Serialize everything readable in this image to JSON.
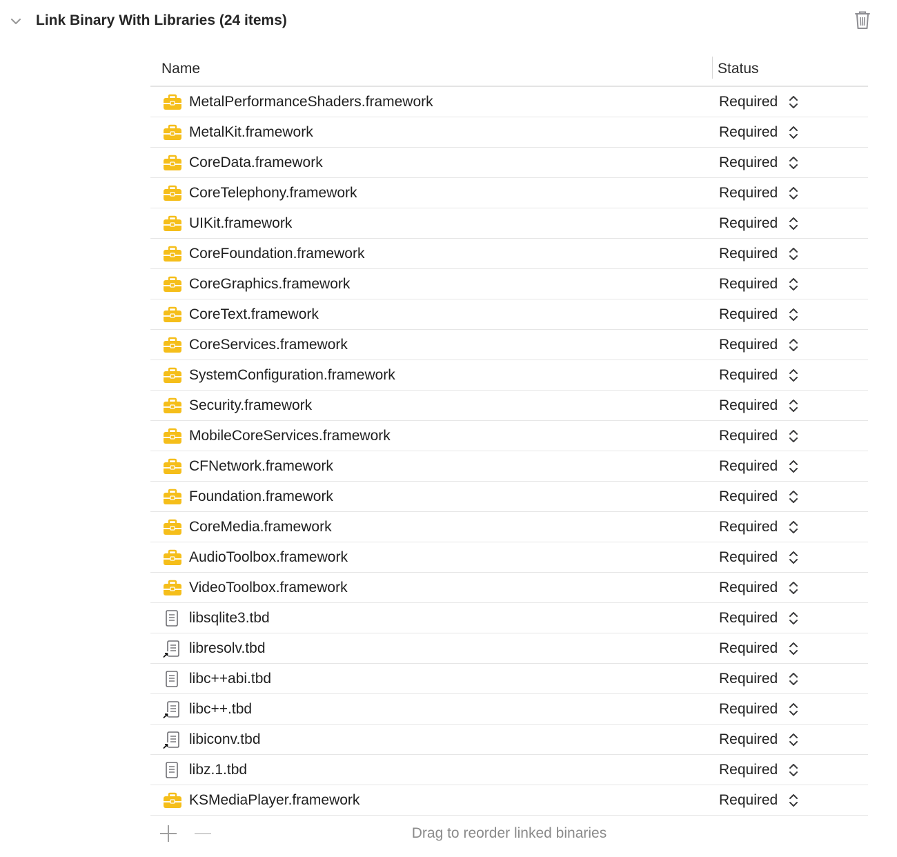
{
  "section": {
    "title": "Link Binary With Libraries (24 items)"
  },
  "columns": {
    "name": "Name",
    "status": "Status"
  },
  "rows": [
    {
      "name": "MetalPerformanceShaders.framework",
      "status": "Required",
      "icon": "framework-toolbox-icon"
    },
    {
      "name": "MetalKit.framework",
      "status": "Required",
      "icon": "framework-toolbox-icon"
    },
    {
      "name": "CoreData.framework",
      "status": "Required",
      "icon": "framework-toolbox-icon"
    },
    {
      "name": "CoreTelephony.framework",
      "status": "Required",
      "icon": "framework-toolbox-icon"
    },
    {
      "name": "UIKit.framework",
      "status": "Required",
      "icon": "framework-toolbox-icon"
    },
    {
      "name": "CoreFoundation.framework",
      "status": "Required",
      "icon": "framework-toolbox-icon"
    },
    {
      "name": "CoreGraphics.framework",
      "status": "Required",
      "icon": "framework-toolbox-icon"
    },
    {
      "name": "CoreText.framework",
      "status": "Required",
      "icon": "framework-toolbox-icon"
    },
    {
      "name": "CoreServices.framework",
      "status": "Required",
      "icon": "framework-toolbox-icon"
    },
    {
      "name": "SystemConfiguration.framework",
      "status": "Required",
      "icon": "framework-toolbox-icon"
    },
    {
      "name": "Security.framework",
      "status": "Required",
      "icon": "framework-toolbox-icon"
    },
    {
      "name": "MobileCoreServices.framework",
      "status": "Required",
      "icon": "framework-toolbox-icon"
    },
    {
      "name": "CFNetwork.framework",
      "status": "Required",
      "icon": "framework-toolbox-icon"
    },
    {
      "name": "Foundation.framework",
      "status": "Required",
      "icon": "framework-toolbox-icon"
    },
    {
      "name": "CoreMedia.framework",
      "status": "Required",
      "icon": "framework-toolbox-icon"
    },
    {
      "name": "AudioToolbox.framework",
      "status": "Required",
      "icon": "framework-toolbox-icon"
    },
    {
      "name": "VideoToolbox.framework",
      "status": "Required",
      "icon": "framework-toolbox-icon"
    },
    {
      "name": "libsqlite3.tbd",
      "status": "Required",
      "icon": "tbd-file-icon"
    },
    {
      "name": "libresolv.tbd",
      "status": "Required",
      "icon": "tbd-file-alias-icon"
    },
    {
      "name": "libc++abi.tbd",
      "status": "Required",
      "icon": "tbd-file-icon"
    },
    {
      "name": "libc++.tbd",
      "status": "Required",
      "icon": "tbd-file-alias-icon"
    },
    {
      "name": "libiconv.tbd",
      "status": "Required",
      "icon": "tbd-file-alias-icon"
    },
    {
      "name": "libz.1.tbd",
      "status": "Required",
      "icon": "tbd-file-icon"
    },
    {
      "name": "KSMediaPlayer.framework",
      "status": "Required",
      "icon": "framework-toolbox-icon"
    }
  ],
  "footer": {
    "hint": "Drag to reorder linked binaries"
  },
  "colors": {
    "framework_icon": "#f5be1a",
    "icon_gray": "#6e6e73",
    "hint_text": "#8a8a8a"
  }
}
